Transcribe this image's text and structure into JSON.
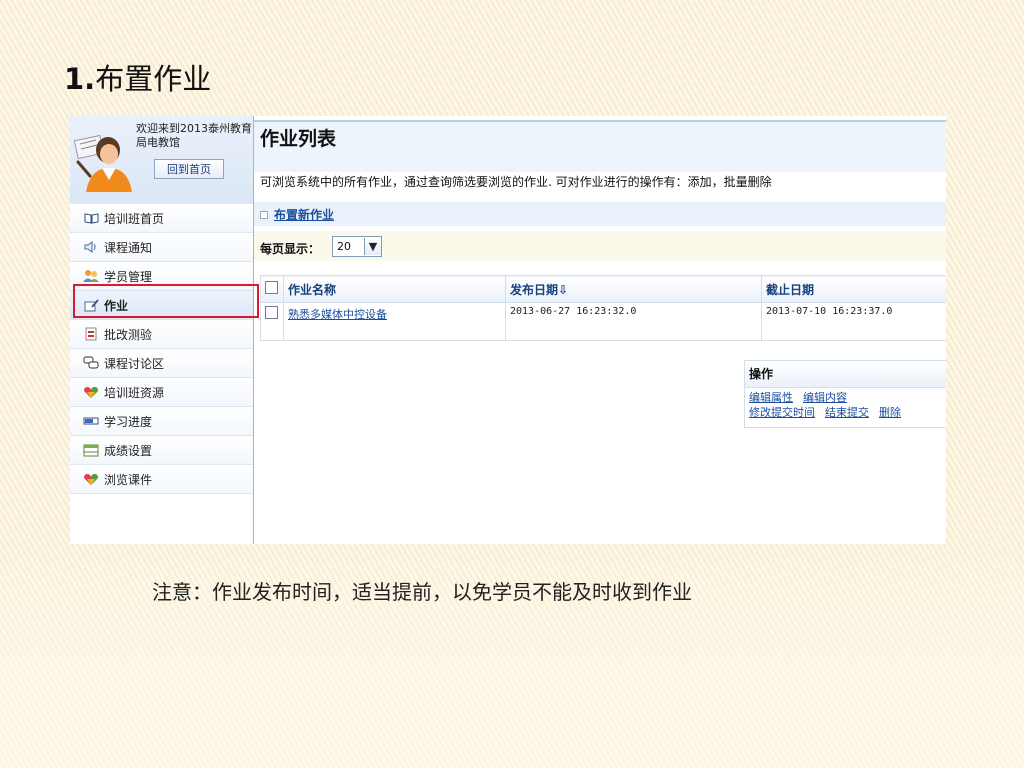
{
  "slide": {
    "title_num": "1.",
    "title_text": "布置作业",
    "note": "注意：作业发布时间，适当提前，以免学员不能及时收到作业"
  },
  "sidebar": {
    "welcome": "欢迎来到2013泰州教育局电教馆",
    "home_button": "回到首页",
    "items": [
      {
        "label": "培训班首页",
        "icon": "book-icon"
      },
      {
        "label": "课程通知",
        "icon": "speaker-icon"
      },
      {
        "label": "学员管理",
        "icon": "users-icon"
      },
      {
        "label": "作业",
        "icon": "edit-doc-icon"
      },
      {
        "label": "批改测验",
        "icon": "grade-icon"
      },
      {
        "label": "课程讨论区",
        "icon": "chat-icon"
      },
      {
        "label": "培训班资源",
        "icon": "heart-gem-icon"
      },
      {
        "label": "学习进度",
        "icon": "progress-icon"
      },
      {
        "label": "成绩设置",
        "icon": "table-icon"
      },
      {
        "label": "浏览课件",
        "icon": "heart-gem-icon"
      }
    ],
    "active_index": 3,
    "highlight_color": "#e0182d"
  },
  "main": {
    "title": "作业列表",
    "description": "可浏览系统中的所有作业，通过查询筛选要浏览的作业. 可对作业进行的操作有：添加，批量删除",
    "add_link": "布置新作业",
    "per_page_label": "每页显示：",
    "per_page_value": "20",
    "table": {
      "headers": [
        "作业名称",
        "发布日期⇩",
        "截止日期"
      ],
      "rows": [
        {
          "name": "熟悉多媒体中控设备",
          "published": "2013-06-27 16:23:32.0",
          "deadline": "2013-07-10 16:23:37.0"
        }
      ]
    },
    "operations": {
      "header": "操作",
      "line1": [
        "编辑属性",
        "编辑内容"
      ],
      "line2": [
        "修改提交时间",
        "结束提交",
        "删除"
      ]
    }
  }
}
